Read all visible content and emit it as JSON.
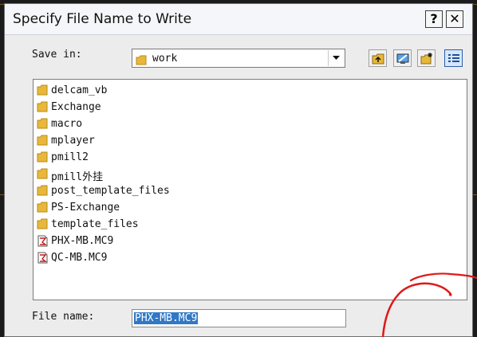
{
  "dialog": {
    "title": "Specify File Name to Write",
    "help_label": "?",
    "close_label": "✕"
  },
  "save_in": {
    "label": "Save in:",
    "value": "work"
  },
  "toolbar": [
    "up-folder-icon",
    "desktop-icon",
    "new-folder-icon",
    "details-view-icon"
  ],
  "files": [
    {
      "name": "delcam_vb",
      "type": "folder"
    },
    {
      "name": "Exchange",
      "type": "folder"
    },
    {
      "name": "macro",
      "type": "folder"
    },
    {
      "name": "mplayer",
      "type": "folder"
    },
    {
      "name": "pmill2",
      "type": "folder"
    },
    {
      "name": "pmill外挂",
      "type": "folder"
    },
    {
      "name": "post_template_files",
      "type": "folder"
    },
    {
      "name": "PS-Exchange",
      "type": "folder"
    },
    {
      "name": "template_files",
      "type": "folder"
    },
    {
      "name": "PHX-MB.MC9",
      "type": "file"
    },
    {
      "name": "QC-MB.MC9",
      "type": "file"
    }
  ],
  "file_name": {
    "label": "File name:",
    "value": "PHX-MB.MC9"
  },
  "colors": {
    "accent": "#3178c6",
    "folder": "#e8b83a",
    "annotation": "#e01818"
  }
}
